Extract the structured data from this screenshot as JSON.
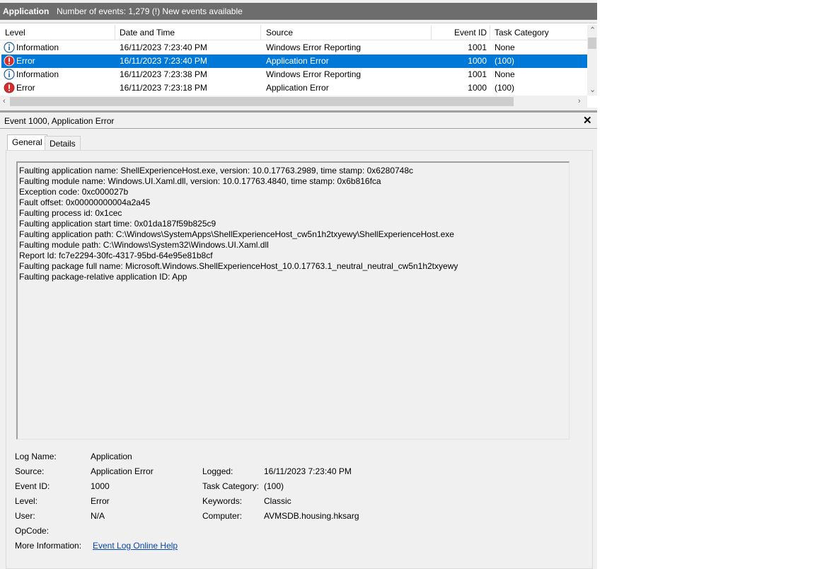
{
  "titlebar": {
    "log": "Application",
    "events_info": "Number of events: 1,279 (!) New events available"
  },
  "columns": {
    "level": "Level",
    "date_time": "Date and Time",
    "source": "Source",
    "event_id": "Event ID",
    "task_category": "Task Category"
  },
  "rows": [
    {
      "level": "Information",
      "date_time": "16/11/2023 7:23:40 PM",
      "source": "Windows Error Reporting",
      "event_id": "1001",
      "task_category": "None",
      "icon": "information-icon"
    },
    {
      "level": "Error",
      "date_time": "16/11/2023 7:23:40 PM",
      "source": "Application Error",
      "event_id": "1000",
      "task_category": "(100)",
      "icon": "error-icon",
      "selected": true
    },
    {
      "level": "Information",
      "date_time": "16/11/2023 7:23:38 PM",
      "source": "Windows Error Reporting",
      "event_id": "1001",
      "task_category": "None",
      "icon": "information-icon"
    },
    {
      "level": "Error",
      "date_time": "16/11/2023 7:23:18 PM",
      "source": "Application Error",
      "event_id": "1000",
      "task_category": "(100)",
      "icon": "error-icon"
    }
  ],
  "details": {
    "title": "Event 1000, Application Error",
    "tabs": [
      "General",
      "Details"
    ],
    "description_lines": [
      "Faulting application name: ShellExperienceHost.exe, version: 10.0.17763.2989, time stamp: 0x6280748c",
      "Faulting module name: Windows.UI.Xaml.dll, version: 10.0.17763.4840, time stamp: 0x6b816fca",
      "Exception code: 0xc000027b",
      "Fault offset: 0x00000000004a2a45",
      "Faulting process id: 0x1cec",
      "Faulting application start time: 0x01da187f59b825c9",
      "Faulting application path: C:\\Windows\\SystemApps\\ShellExperienceHost_cw5n1h2txyewy\\ShellExperienceHost.exe",
      "Faulting module path: C:\\Windows\\System32\\Windows.UI.Xaml.dll",
      "Report Id: fc7e2294-30fc-4317-95bd-64e95e81b8cf",
      "Faulting package full name: Microsoft.Windows.ShellExperienceHost_10.0.17763.1_neutral_neutral_cw5n1h2txyewy",
      "Faulting package-relative application ID: App"
    ],
    "fields": {
      "log_name_label": "Log Name:",
      "log_name": "Application",
      "source_label": "Source:",
      "source": "Application Error",
      "logged_label": "Logged:",
      "logged": "16/11/2023 7:23:40 PM",
      "event_id_label": "Event ID:",
      "event_id": "1000",
      "task_category_label": "Task Category:",
      "task_category": "(100)",
      "level_label": "Level:",
      "level": "Error",
      "keywords_label": "Keywords:",
      "keywords": "Classic",
      "user_label": "User:",
      "user": "N/A",
      "computer_label": "Computer:",
      "computer": "AVMSDB.housing.hksarg",
      "opcode_label": "OpCode:",
      "more_info_label": "More Information:",
      "more_info_link": "Event Log Online Help"
    }
  },
  "colors": {
    "selection": "#0078d7",
    "titlebar": "#6d6d6d",
    "info_icon": "#1c5ea8",
    "error_icon": "#d32f2f",
    "link": "#0645ad"
  }
}
